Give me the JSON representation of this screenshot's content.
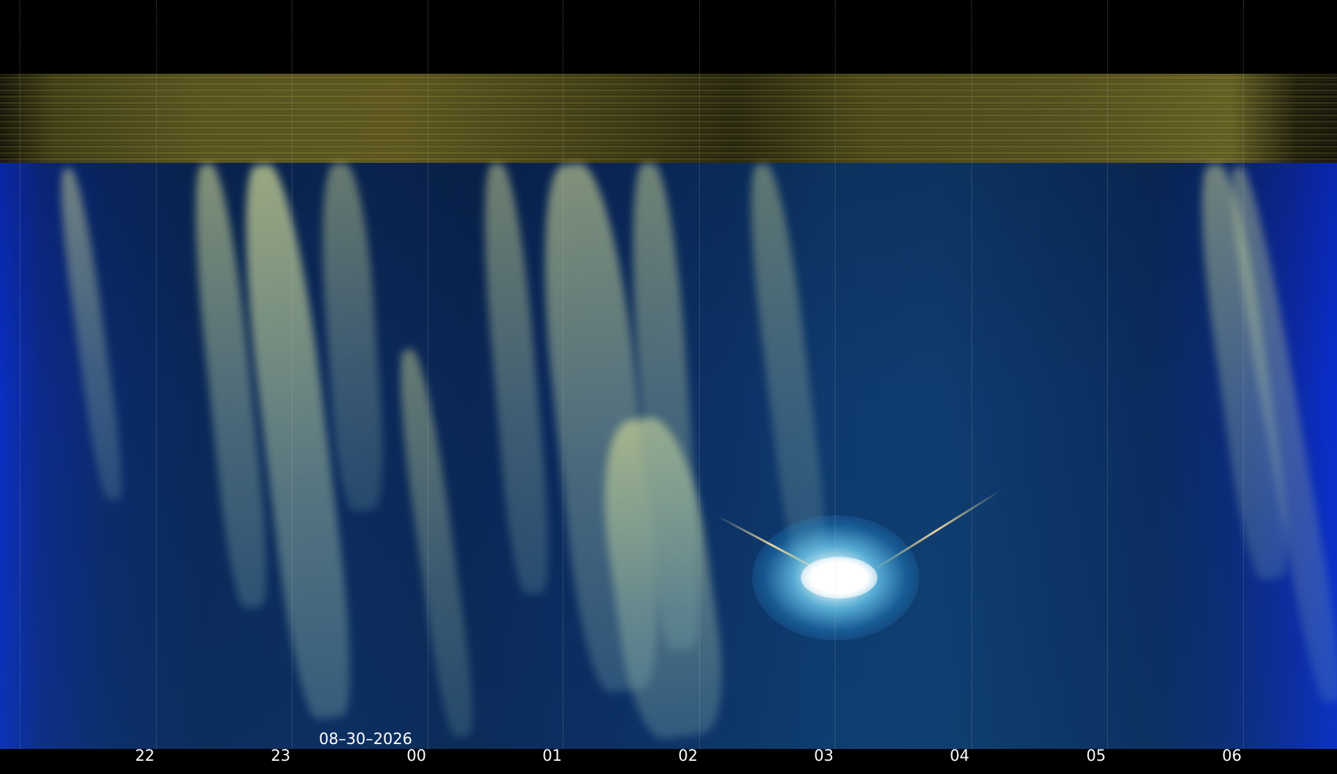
{
  "image": {
    "description": "keogram-style sky timelapse strip",
    "colors": {
      "sky": "#0a2a60",
      "edge_blue": "#0a2ed0",
      "cloud": "#c8d496",
      "band": "#5a5622",
      "text": "#ffffff"
    }
  },
  "date_label": "08–30–2026",
  "time_ticks": [
    "22",
    "23",
    "00",
    "01",
    "02",
    "03",
    "04",
    "05",
    "06"
  ]
}
